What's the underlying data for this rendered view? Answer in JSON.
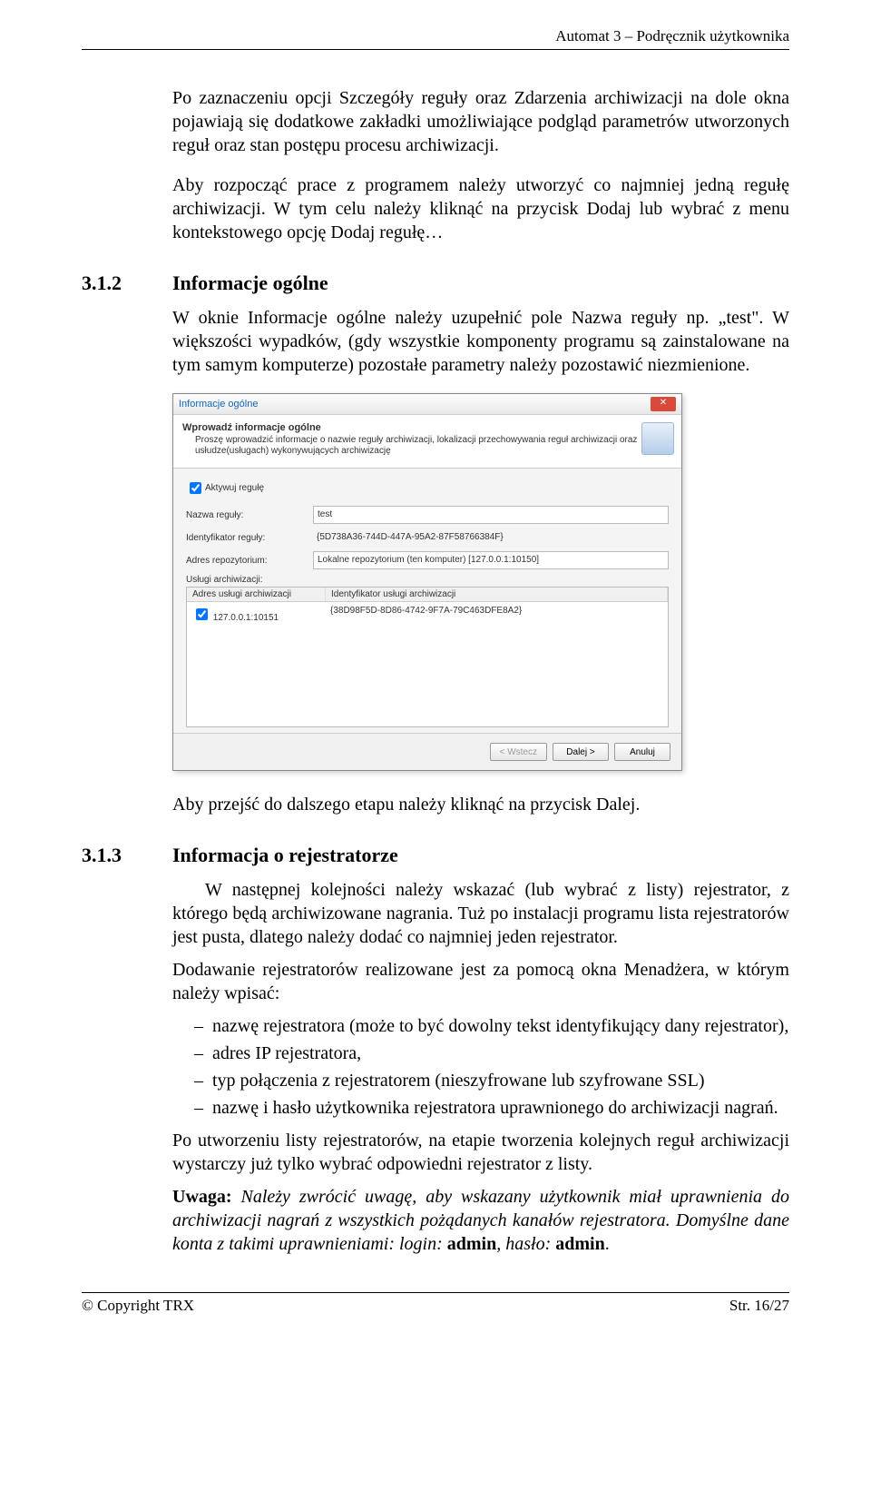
{
  "header": {
    "right": "Automat 3 – Podręcznik użytkownika"
  },
  "para1": "Po zaznaczeniu opcji Szczegóły reguły oraz Zdarzenia archiwizacji na dole okna pojawiają się dodatkowe zakładki umożliwiające podgląd parametrów utworzonych reguł oraz stan postępu procesu archiwizacji.",
  "para2": "Aby rozpocząć prace z programem należy utworzyć co najmniej jedną regułę archiwizacji. W tym celu należy kliknąć na przycisk Dodaj lub wybrać z menu kontekstowego opcję Dodaj regułę…",
  "sec312": {
    "num": "3.1.2",
    "title": "Informacje ogólne"
  },
  "sec312_para": "W oknie Informacje ogólne należy uzupełnić pole Nazwa reguły np. „test\". W większości wypadków, (gdy wszystkie komponenty programu są zainstalowane na tym samym komputerze) pozostałe parametry należy pozostawić niezmienione.",
  "dialog": {
    "title": "Informacje ogólne",
    "header_h1": "Wprowadź informacje ogólne",
    "header_sub": "Proszę wprowadzić informacje o nazwie reguły archiwizacji, lokalizacji przechowywania reguł archiwizacji oraz usłudze(usługach) wykonywujących archiwizację",
    "chk_activate": "Aktywuj regułę",
    "name_lbl": "Nazwa reguły:",
    "name_val": "test",
    "id_lbl": "Identyfikator reguły:",
    "id_val": "{5D738A36-744D-447A-95A2-87F58766384F}",
    "repo_lbl": "Adres repozytorium:",
    "repo_val": "Lokalne repozytorium (ten komputer) [127.0.0.1:10150]",
    "svc_lbl": "Usługi archiwizacji:",
    "svc_hdr_a": "Adres usługi archiwizacji",
    "svc_hdr_b": "Identyfikator usługi archiwizacji",
    "svc_row_a": "127.0.0.1:10151",
    "svc_row_b": "{38D98F5D-8D86-4742-9F7A-79C463DFE8A2}",
    "btn_back": "< Wstecz",
    "btn_next": "Dalej >",
    "btn_cancel": "Anuluj"
  },
  "para_after_dialog": "Aby przejść do dalszego etapu należy kliknąć na przycisk Dalej.",
  "sec313": {
    "num": "3.1.3",
    "title": "Informacja o rejestratorze"
  },
  "sec313_p1": "W następnej kolejności należy wskazać (lub wybrać z listy) rejestrator, z którego będą archiwizowane nagrania. Tuż po instalacji programu lista rejestratorów jest pusta, dlatego należy dodać co najmniej jeden rejestrator.",
  "sec313_p2": "Dodawanie rejestratorów realizowane jest za pomocą okna Menadżera, w którym należy wpisać:",
  "sec313_items": [
    "nazwę rejestratora (może to być dowolny tekst identyfikujący dany rejestrator),",
    "adres IP rejestratora,",
    "typ połączenia z rejestratorem (nieszyfrowane lub szyfrowane SSL)",
    "nazwę i hasło użytkownika rejestratora uprawnionego do archiwizacji nagrań."
  ],
  "sec313_p3": "Po utworzeniu listy rejestratorów, na etapie tworzenia kolejnych reguł archiwizacji wystarczy już tylko wybrać odpowiedni rejestrator z listy.",
  "sec313_note_label": "Uwaga:",
  "sec313_note_body": " Należy zwrócić uwagę, aby wskazany użytkownik miał uprawnienia do archiwizacji nagrań z wszystkich pożądanych kanałów rejestratora. Domyślne dane konta z takimi uprawnieniami: login: ",
  "sec313_note_admin": "admin",
  "sec313_note_haslo_lbl": ", hasło: ",
  "sec313_note_admin2": "admin",
  "footer": {
    "left": "© Copyright TRX",
    "right": "Str. 16/27"
  }
}
